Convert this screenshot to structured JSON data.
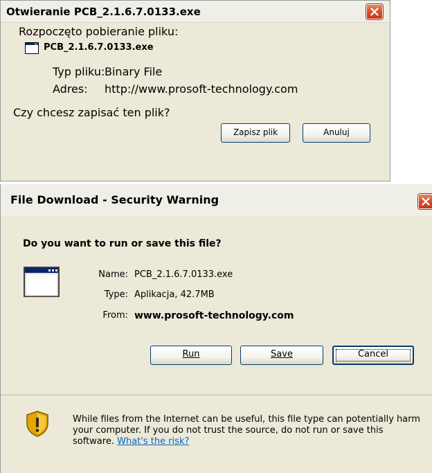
{
  "dialog_pl": {
    "title": "Otwieranie PCB_2.1.6.7.0133.exe",
    "intro": "Rozpoczęto pobieranie pliku:",
    "file_name": "PCB_2.1.6.7.0133.exe",
    "type_label": "Typ pliku:",
    "type_value": "Binary File",
    "address_label": "Adres:",
    "address_value": "http://www.prosoft-technology.com",
    "question": "Czy chcesz zapisać ten plik?",
    "save_label": "Zapisz plik",
    "cancel_label": "Anuluj"
  },
  "security_warning": {
    "title": "File Download - Security Warning",
    "question": "Do you want to run or save this file?",
    "name_label": "Name:",
    "name_value": "PCB_2.1.6.7.0133.exe",
    "type_label": "Type:",
    "type_value": "Aplikacja, 42.7MB",
    "from_label": "From:",
    "from_value": "www.prosoft-technology.com",
    "run_label": "Run",
    "save_label": "Save",
    "cancel_label": "Cancel",
    "warning_text": "While files from the Internet can be useful, this file type can potentially harm your computer. If you do not trust the source, do not run or save this software.",
    "risk_link": "What's the risk?"
  },
  "icons": {
    "close": "close-icon",
    "file": "application-file-icon",
    "shield": "security-shield-icon"
  },
  "colors": {
    "dialog_bg": "#ece9d8",
    "close_red": "#d8532f",
    "link": "#0066cc",
    "button_border": "#003c74"
  }
}
